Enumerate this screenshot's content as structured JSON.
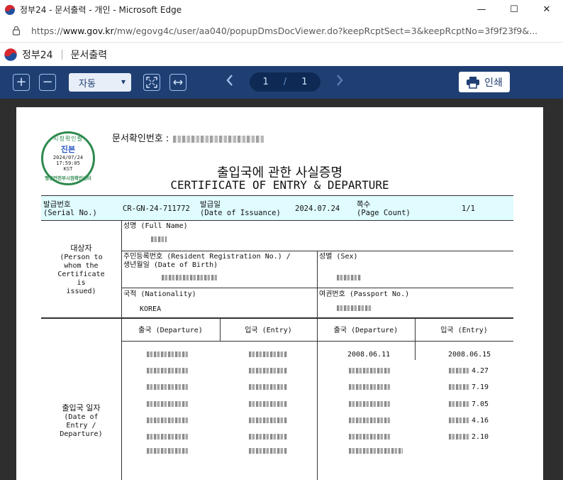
{
  "window": {
    "title": "정부24 - 문서출력 - 개인 - Microsoft Edge",
    "controls": [
      "—",
      "☐",
      "✕"
    ]
  },
  "address": {
    "url_prefix": "https://",
    "url_host": "www.gov.kr",
    "url_rest": "/mw/egovg4c/user/aa040/popupDmsDocViewer.do?keepRcptSect=3&keepRcptNo=3f9f23f9&..."
  },
  "site": {
    "brand": "정부24",
    "subtitle": "문서출력"
  },
  "toolbar": {
    "zoom_in_label": "+",
    "zoom_out_label": "−",
    "zoom_value": "자동",
    "page_current": "1",
    "page_sep": "/",
    "page_total": "1",
    "print_label": "인쇄"
  },
  "document": {
    "seal": {
      "top_text": "시청확인필",
      "center": "진본",
      "date": "2024/07/24",
      "time": "17:59:05",
      "tz": "KST",
      "bottom_text": "행정안전부시점확인센터"
    },
    "doc_number_label": "문서확인번호 :",
    "title_ko": "출입국에 관한 사실증명",
    "title_en": "CERTIFICATE OF ENTRY & DEPARTURE",
    "band": {
      "serial_label_ko": "발급번호",
      "serial_label_en": "(Serial No.)",
      "serial_value": "CR-GN-24-711772",
      "issuance_label_ko": "발급일",
      "issuance_label_en": "(Date of Issuance)",
      "issuance_value": "2024.07.24",
      "page_label_ko": "쪽수",
      "page_label_en": "(Page Count)",
      "page_value": "1/1"
    },
    "subject": {
      "label_ko": "대상자",
      "label_en_1": "(Person to",
      "label_en_2": "whom the",
      "label_en_3": "Certificate",
      "label_en_4": "is",
      "label_en_5": "issued)",
      "name_label": "성명 (Full Name)",
      "rrn_label": "주민등록번호 (Resident Registration No.) /",
      "dob_label": "생년월일 (Date of Birth)",
      "sex_label": "성별 (Sex)",
      "nationality_label": "국적 (Nationality)",
      "nationality_value": "KOREA",
      "passport_label": "여권번호 (Passport No.)"
    },
    "dates": {
      "label_ko": "출입국 일자",
      "label_en_1": "(Date of",
      "label_en_2": "Entry /",
      "label_en_3": "Departure)",
      "col_departure": "출국 (Departure)",
      "col_entry": "입국 (Entry)",
      "col_departure_2": "출국 (Departure)",
      "col_entry_2": "입국 (Entry)",
      "row1_departure_2": "2008.06.11",
      "row1_entry_2": "2008.06.15",
      "partial_entries": [
        "4.27",
        "7.19",
        "7.05",
        "4.16",
        "2.10"
      ]
    }
  }
}
